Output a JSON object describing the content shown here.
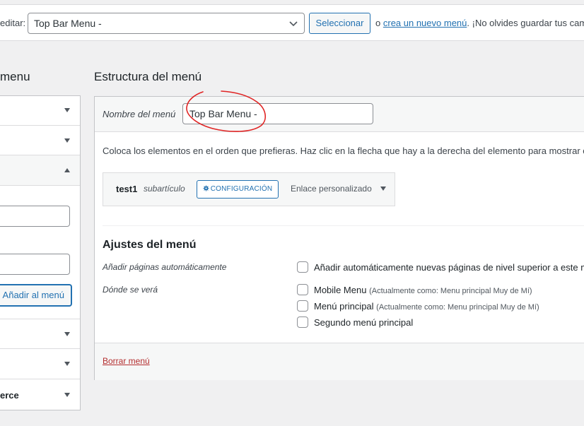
{
  "top_bar": {
    "edit_label": "editar:",
    "selected_menu": "Top Bar Menu -",
    "select_button": "Seleccionar",
    "or_text": "o",
    "create_link": "crea un nuevo menú",
    "reminder": ". ¡No olvides guardar tus cam"
  },
  "sidebar": {
    "title": "menu",
    "add_button": "Añadir al menú",
    "last_section_label": "erce"
  },
  "structure": {
    "title": "Estructura del menú",
    "name_label": "Nombre del menú",
    "name_value": "Top Bar Menu -",
    "instructions": "Coloca los elementos en el orden que prefieras. Haz clic en la flecha que hay a la derecha del elemento para mostrar op",
    "item": {
      "title": "test1",
      "subtitle": "subartículo",
      "config_label": "CONFIGURACIÓN",
      "type": "Enlace personalizado"
    }
  },
  "settings": {
    "title": "Ajustes del menú",
    "auto_add_label": "Añadir páginas automáticamente",
    "auto_add_option": "Añadir automáticamente nuevas páginas de nivel superior a este m",
    "location_label": "Dónde se verá",
    "locations": [
      {
        "label": "Mobile Menu",
        "note": "(Actualmente como: Menu principal Muy de Mí)"
      },
      {
        "label": "Menú principal",
        "note": "(Actualmente como: Menu principal Muy de Mí)"
      },
      {
        "label": "Segundo menú principal",
        "note": ""
      }
    ]
  },
  "footer": {
    "delete_link": "Borrar menú"
  },
  "colors": {
    "accent": "#2271b1",
    "danger": "#b32d2e",
    "annotation": "#e02424"
  }
}
